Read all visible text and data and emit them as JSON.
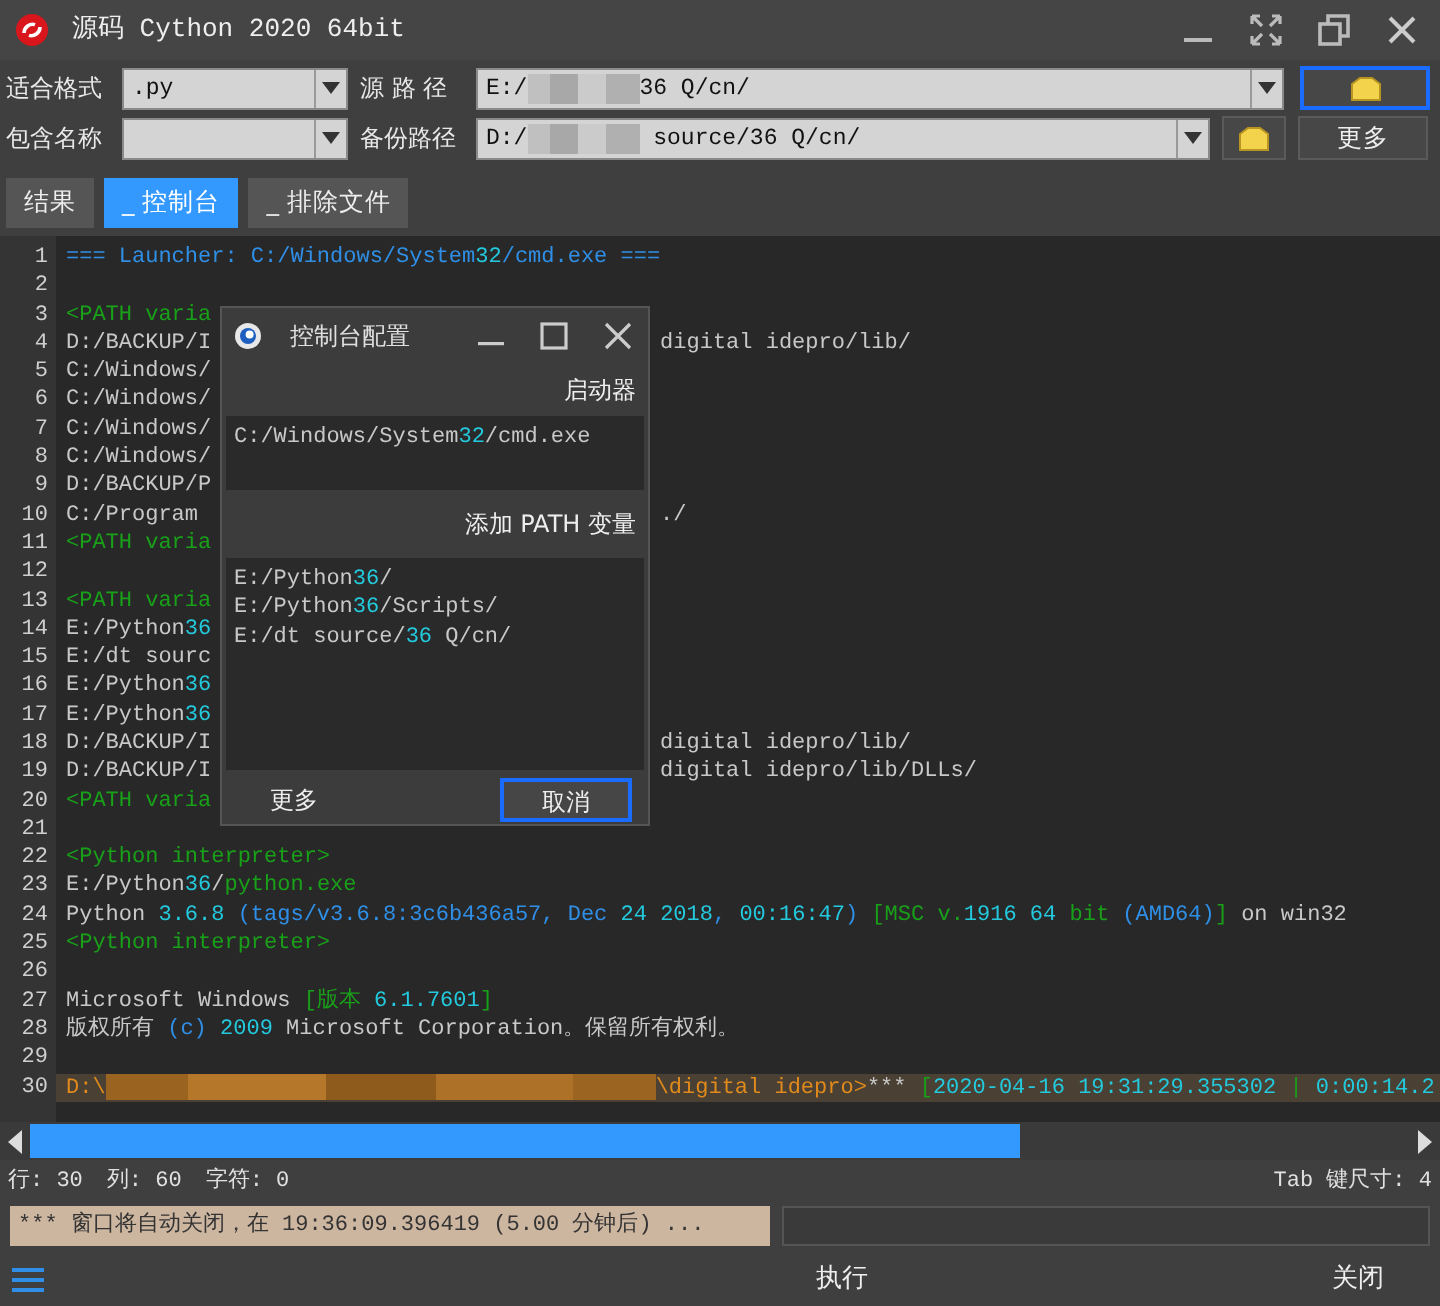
{
  "window": {
    "title": "源码 Cython 2020 64bit"
  },
  "form": {
    "format": {
      "label": "适合格式",
      "value": ".py"
    },
    "source_path": {
      "label": "源 路 径",
      "value": [
        {
          "kind": "plain",
          "text": "E:/"
        },
        {
          "kind": "redacted"
        },
        {
          "kind": "plain",
          "text": "36 Q/cn/"
        }
      ],
      "folder_button": {
        "focused": true
      }
    },
    "include_name": {
      "label": "包含名称"
    },
    "backup_path": {
      "label": "备份路径",
      "value": [
        {
          "kind": "plain",
          "text": "D:/"
        },
        {
          "kind": "redacted"
        },
        {
          "kind": "plain",
          "text": " source/36 Q/cn/"
        }
      ],
      "folder_button": {
        "focused": false
      }
    },
    "more_button": "更多"
  },
  "tabs": [
    {
      "label": "结果",
      "selected": false
    },
    {
      "label": "_ 控制台",
      "selected": true
    },
    {
      "label": "_ 排除文件",
      "selected": false
    }
  ],
  "editor": {
    "lines": [
      {
        "number": "1",
        "highlighted": false,
        "segments": [
          {
            "kind": "blue",
            "text": "=== Launcher: C:/Windows/System"
          },
          {
            "kind": "cyan",
            "text": "32"
          },
          {
            "kind": "blue",
            "text": "/cmd.exe ==="
          }
        ]
      },
      {
        "number": "2",
        "highlighted": false
      },
      {
        "number": "3",
        "highlighted": false,
        "segments": [
          {
            "kind": "green",
            "text": "<PATH varia"
          }
        ]
      },
      {
        "number": "4",
        "highlighted": false,
        "segments": [
          {
            "kind": "plain",
            "text": "D:/BACKUP/I"
          }
        ],
        "after": [
          {
            "kind": "plain",
            "text": "digital idepro/lib/"
          }
        ]
      },
      {
        "number": "5",
        "highlighted": false,
        "segments": [
          {
            "kind": "plain",
            "text": "C:/Windows/"
          }
        ]
      },
      {
        "number": "6",
        "highlighted": false,
        "segments": [
          {
            "kind": "plain",
            "text": "C:/Windows/"
          }
        ]
      },
      {
        "number": "7",
        "highlighted": false,
        "segments": [
          {
            "kind": "plain",
            "text": "C:/Windows/"
          }
        ]
      },
      {
        "number": "8",
        "highlighted": false,
        "segments": [
          {
            "kind": "plain",
            "text": "C:/Windows/"
          }
        ]
      },
      {
        "number": "9",
        "highlighted": false,
        "segments": [
          {
            "kind": "plain",
            "text": "D:/BACKUP/P"
          }
        ]
      },
      {
        "number": "10",
        "highlighted": false,
        "segments": [
          {
            "kind": "plain",
            "text": "C:/Program"
          }
        ],
        "after": [
          {
            "kind": "plain",
            "text": "./"
          }
        ]
      },
      {
        "number": "11",
        "highlighted": false,
        "segments": [
          {
            "kind": "green",
            "text": "<PATH varia"
          }
        ]
      },
      {
        "number": "12",
        "highlighted": false
      },
      {
        "number": "13",
        "highlighted": false,
        "segments": [
          {
            "kind": "green",
            "text": "<PATH varia"
          }
        ]
      },
      {
        "number": "14",
        "highlighted": false,
        "segments": [
          {
            "kind": "plain",
            "text": "E:/Python"
          },
          {
            "kind": "cyan",
            "text": "36"
          }
        ]
      },
      {
        "number": "15",
        "highlighted": false,
        "segments": [
          {
            "kind": "plain",
            "text": "E:/dt sourc"
          }
        ]
      },
      {
        "number": "16",
        "highlighted": false,
        "segments": [
          {
            "kind": "plain",
            "text": "E:/Python"
          },
          {
            "kind": "cyan",
            "text": "36"
          }
        ]
      },
      {
        "number": "17",
        "highlighted": false,
        "segments": [
          {
            "kind": "plain",
            "text": "E:/Python"
          },
          {
            "kind": "cyan",
            "text": "36"
          }
        ]
      },
      {
        "number": "18",
        "highlighted": false,
        "segments": [
          {
            "kind": "plain",
            "text": "D:/BACKUP/I"
          }
        ],
        "after": [
          {
            "kind": "plain",
            "text": "digital idepro/lib/"
          }
        ]
      },
      {
        "number": "19",
        "highlighted": false,
        "segments": [
          {
            "kind": "plain",
            "text": "D:/BACKUP/I"
          }
        ],
        "after": [
          {
            "kind": "plain",
            "text": "digital idepro/lib/DLLs/"
          }
        ]
      },
      {
        "number": "20",
        "highlighted": false,
        "segments": [
          {
            "kind": "green",
            "text": "<PATH varia"
          }
        ]
      },
      {
        "number": "21",
        "highlighted": false
      },
      {
        "number": "22",
        "highlighted": false,
        "segments": [
          {
            "kind": "green",
            "text": "<Python interpreter>"
          }
        ]
      },
      {
        "number": "23",
        "highlighted": false,
        "segments": [
          {
            "kind": "plain",
            "text": "E:/Python"
          },
          {
            "kind": "cyan",
            "text": "36"
          },
          {
            "kind": "plain",
            "text": "/"
          },
          {
            "kind": "green",
            "text": "python.exe"
          }
        ]
      },
      {
        "number": "24",
        "highlighted": false,
        "segments": [
          {
            "kind": "plain",
            "text": "Python "
          },
          {
            "kind": "cyan",
            "text": "3.6.8 "
          },
          {
            "kind": "blue",
            "text": "(tags/v3.6.8:3c6b436a57, Dec "
          },
          {
            "kind": "cyan",
            "text": "24 2018"
          },
          {
            "kind": "blue",
            "text": ", "
          },
          {
            "kind": "cyan",
            "text": "00:16:47"
          },
          {
            "kind": "blue",
            "text": ")"
          },
          {
            "kind": "green",
            "text": " [MSC v."
          },
          {
            "kind": "cyan",
            "text": "1916 64"
          },
          {
            "kind": "green",
            "text": " bit "
          },
          {
            "kind": "blue",
            "text": "(AMD64)"
          },
          {
            "kind": "green",
            "text": "]"
          },
          {
            "kind": "plain",
            "text": " on win32"
          }
        ]
      },
      {
        "number": "25",
        "highlighted": false,
        "segments": [
          {
            "kind": "green",
            "text": "<Python interpreter>"
          }
        ]
      },
      {
        "number": "26",
        "highlighted": false
      },
      {
        "number": "27",
        "highlighted": false,
        "segments": [
          {
            "kind": "plain",
            "text": "Microsoft Windows "
          },
          {
            "kind": "green",
            "text": "[版本"
          },
          {
            "kind": "cyan",
            "text": " 6.1.7601"
          },
          {
            "kind": "green",
            "text": "]"
          }
        ]
      },
      {
        "number": "28",
        "highlighted": false,
        "segments": [
          {
            "kind": "plain",
            "text": "版权所有 "
          },
          {
            "kind": "blue",
            "text": "(c)"
          },
          {
            "kind": "cyan",
            "text": " 2009"
          },
          {
            "kind": "plain",
            "text": " Microsoft Corporation。保留所有权利。"
          }
        ]
      },
      {
        "number": "29",
        "highlighted": false
      },
      {
        "number": "30",
        "highlighted": true,
        "segments": [
          {
            "kind": "orange",
            "text": "D:\\"
          },
          {
            "kind": "redacted"
          },
          {
            "kind": "orange",
            "text": "\\digital idepro>"
          },
          {
            "kind": "plain",
            "text": "***"
          },
          {
            "kind": "green",
            "text": " ["
          },
          {
            "kind": "cyan",
            "text": "2020-04-16 19:31:29.355302"
          },
          {
            "kind": "green",
            "text": " | "
          },
          {
            "kind": "cyan",
            "text": "0:00:14.2"
          }
        ]
      }
    ]
  },
  "status": {
    "items": [
      "行: 30",
      "列: 60",
      "字符: 0"
    ],
    "tab_size": "Tab 键尺寸: 4"
  },
  "message": "*** 窗口将自动关闭，在 19:36:09.396419 (5.00 分钟后) ...",
  "bottom": {
    "run": "执行",
    "close": "关闭"
  },
  "dialog": {
    "title": "控制台配置",
    "launcher_label": "启动器",
    "launcher": [
      {
        "kind": "plain",
        "text": "C:/Windows/System"
      },
      {
        "kind": "cyan",
        "text": "32"
      },
      {
        "kind": "plain",
        "text": "/cmd.exe"
      }
    ],
    "path_label": "添加 PATH 变量",
    "paths": [
      [
        {
          "kind": "plain",
          "text": "E:/Python"
        },
        {
          "kind": "cyan",
          "text": "36"
        },
        {
          "kind": "plain",
          "text": "/"
        }
      ],
      [
        {
          "kind": "plain",
          "text": "E:/Python"
        },
        {
          "kind": "cyan",
          "text": "36"
        },
        {
          "kind": "plain",
          "text": "/Scripts/"
        }
      ],
      [
        {
          "kind": "plain",
          "text": "E:/dt source/"
        },
        {
          "kind": "cyan",
          "text": "36"
        },
        {
          "kind": "plain",
          "text": " Q/cn/"
        }
      ]
    ],
    "more_button": {
      "label": "更多",
      "focused": false
    },
    "cancel_button": {
      "label": "取消",
      "focused": true
    }
  }
}
